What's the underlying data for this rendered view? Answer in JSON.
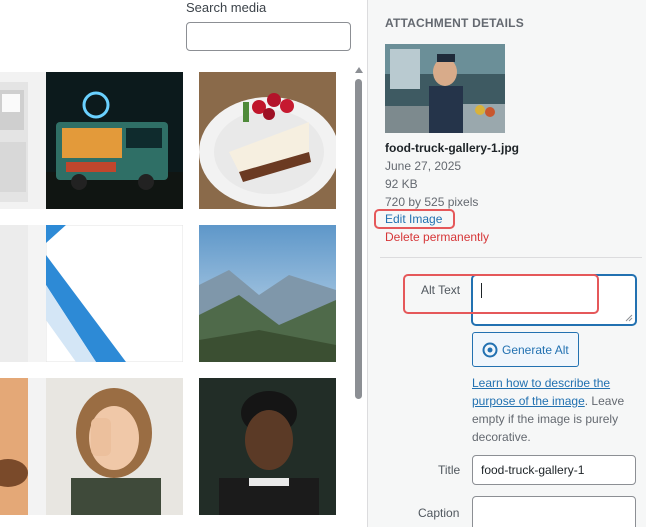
{
  "search": {
    "label": "Search media",
    "value": ""
  },
  "grid": {
    "items": [
      {
        "name": "food-truck-sign-partial"
      },
      {
        "name": "food-truck-night"
      },
      {
        "name": "cheesecake-slice"
      },
      {
        "name": "white-placeholder-partial"
      },
      {
        "name": "blue-stripe-graphic"
      },
      {
        "name": "mountain-valley"
      },
      {
        "name": "person-partial"
      },
      {
        "name": "woman-laughing"
      },
      {
        "name": "man-smiling"
      }
    ]
  },
  "sidebar": {
    "heading": "ATTACHMENT DETAILS",
    "filename": "food-truck-gallery-1.jpg",
    "date": "June 27, 2025",
    "size": "92 KB",
    "dimensions": "720 by 525 pixels",
    "edit_link": "Edit Image",
    "delete_link": "Delete permanently",
    "alt_text": {
      "label": "Alt Text",
      "value": ""
    },
    "generate_alt_button": "Generate Alt",
    "help_link": "Learn how to describe the purpose of the image",
    "help_rest": ". Leave empty if the image is purely decorative.",
    "title": {
      "label": "Title",
      "value": "food-truck-gallery-1"
    },
    "caption": {
      "label": "Caption",
      "value": ""
    }
  },
  "colors": {
    "link": "#2271b1",
    "danger": "#d63638",
    "highlight": "#e5585a"
  }
}
